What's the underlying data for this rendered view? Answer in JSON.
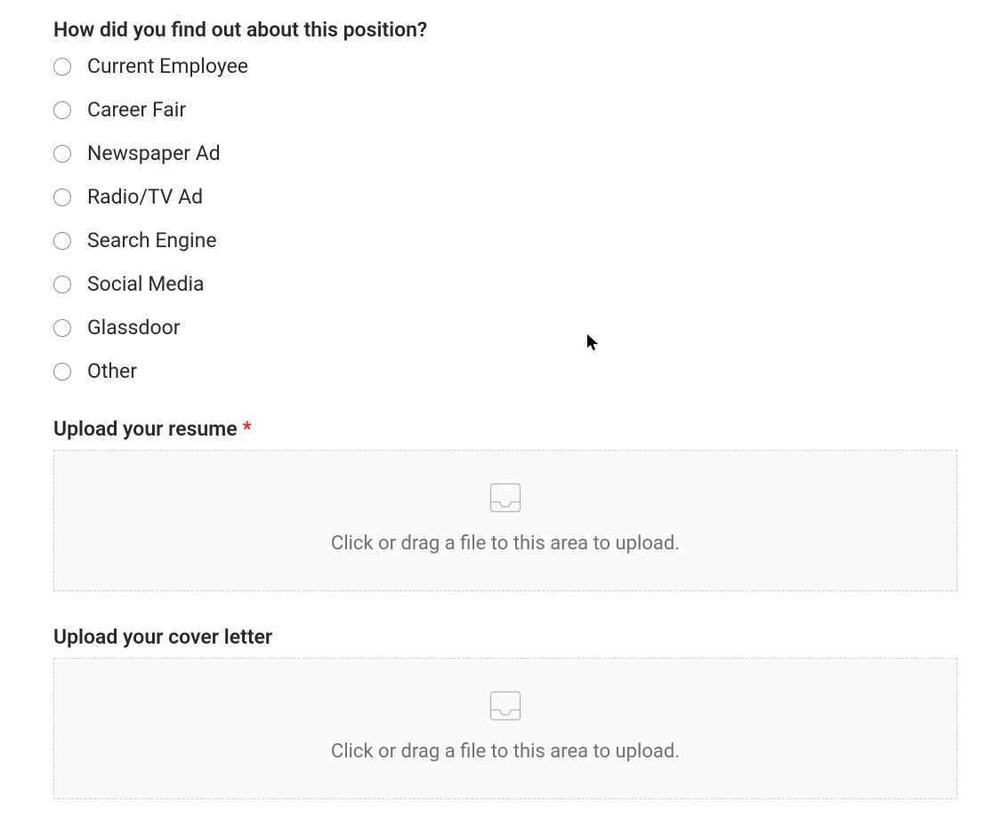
{
  "referralQuestion": {
    "label": "How did you find out about this position?",
    "options": [
      "Current Employee",
      "Career Fair",
      "Newspaper Ad",
      "Radio/TV Ad",
      "Search Engine",
      "Social Media",
      "Glassdoor",
      "Other"
    ]
  },
  "resumeUpload": {
    "label": "Upload your resume",
    "required": true,
    "requiredMark": "*",
    "hint": "Click or drag a file to this area to upload."
  },
  "coverLetterUpload": {
    "label": "Upload your cover letter",
    "required": false,
    "hint": "Click or drag a file to this area to upload."
  }
}
